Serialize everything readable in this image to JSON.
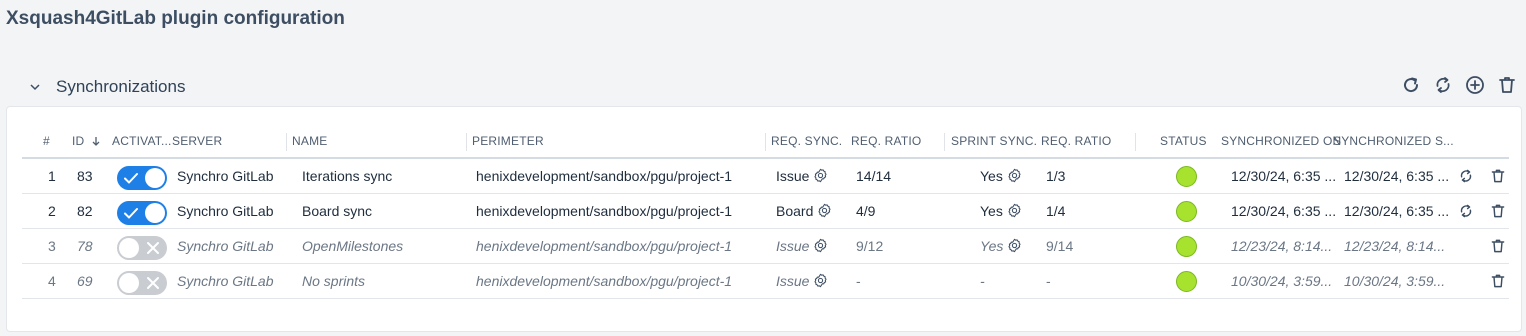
{
  "page": {
    "title": "Xsquash4GitLab plugin configuration"
  },
  "section": {
    "title": "Synchronizations",
    "toolbar": [
      "refresh-icon",
      "sync-all-icon",
      "add-icon",
      "delete-icon"
    ]
  },
  "table": {
    "headers": {
      "index": "#",
      "id": "ID",
      "activated": "ACTIVAT...",
      "server": "SERVER",
      "name": "NAME",
      "perimeter": "PERIMETER",
      "req_sync": "REQ. SYNC.",
      "req_ratio": "REQ. RATIO",
      "sprint_sync": "SPRINT SYNC.",
      "req_ratio_2": "REQ. RATIO",
      "status": "STATUS",
      "synchronized_on": "SYNCHRONIZED ON",
      "synchronized_s": "SYNCHRONIZED S..."
    },
    "sort": {
      "column": "id",
      "direction": "descending"
    },
    "rows": [
      {
        "index": "1",
        "id": "83",
        "activated": true,
        "server": "Synchro GitLab",
        "name": "Iterations sync",
        "perimeter": "henixdevelopment/sandbox/pgu/project-1",
        "req_sync": "Issue",
        "req_ratio": "14/14",
        "sprint_sync": "Yes",
        "req_ratio_2": "1/3",
        "status_color": "#a6e22e",
        "synchronized_on": "12/30/24, 6:35 ...",
        "synchronized_s": "12/30/24, 6:35 ...",
        "can_sync": true
      },
      {
        "index": "2",
        "id": "82",
        "activated": true,
        "server": "Synchro GitLab",
        "name": "Board sync",
        "perimeter": "henixdevelopment/sandbox/pgu/project-1",
        "req_sync": "Board",
        "req_ratio": "4/9",
        "sprint_sync": "Yes",
        "req_ratio_2": "1/4",
        "status_color": "#a6e22e",
        "synchronized_on": "12/30/24, 6:35 ...",
        "synchronized_s": "12/30/24, 6:35 ...",
        "can_sync": true
      },
      {
        "index": "3",
        "id": "78",
        "activated": false,
        "server": "Synchro GitLab",
        "name": "OpenMilestones",
        "perimeter": "henixdevelopment/sandbox/pgu/project-1",
        "req_sync": "Issue",
        "req_ratio": "9/12",
        "sprint_sync": "Yes",
        "req_ratio_2": "9/14",
        "status_color": "#a6e22e",
        "synchronized_on": "12/23/24, 8:14...",
        "synchronized_s": "12/23/24, 8:14...",
        "can_sync": false
      },
      {
        "index": "4",
        "id": "69",
        "activated": false,
        "server": "Synchro GitLab",
        "name": "No sprints",
        "perimeter": "henixdevelopment/sandbox/pgu/project-1",
        "req_sync": "Issue",
        "req_ratio": "-",
        "sprint_sync": "-",
        "req_ratio_2": "-",
        "status_color": "#a6e22e",
        "synchronized_on": "10/30/24, 3:59...",
        "synchronized_s": "10/30/24, 3:59...",
        "can_sync": false
      }
    ]
  }
}
